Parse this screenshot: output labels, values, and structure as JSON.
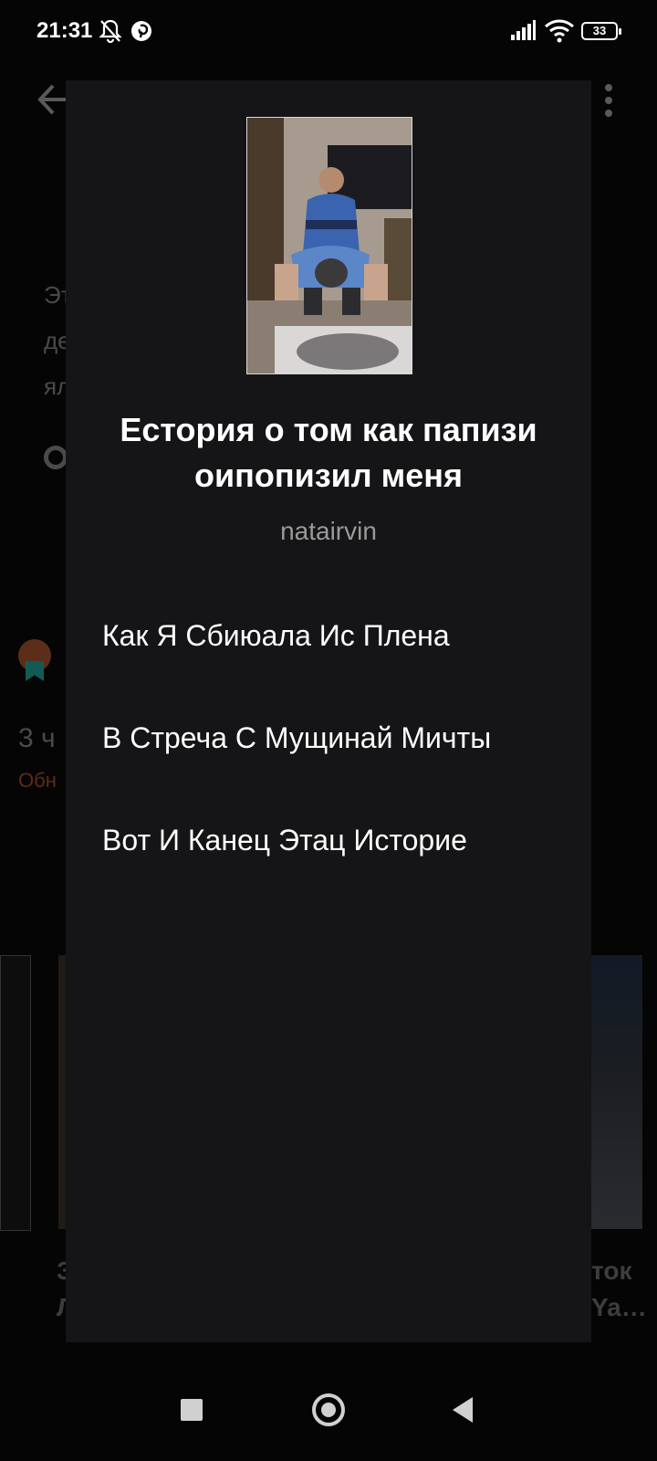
{
  "status_bar": {
    "time": "21:31",
    "battery": "33",
    "icons": [
      "bell-off-icon",
      "pinterest-icon",
      "signal-icon",
      "wifi-icon",
      "battery-icon"
    ]
  },
  "background": {
    "fragments": {
      "line1": "Эт",
      "line2": "де",
      "line3": "ял",
      "parts_count": "3 ч",
      "updated": "Обн",
      "bottom_left_1": "З",
      "bottom_left_2": "Л",
      "bottom_right_1": "ток",
      "bottom_right_2": "Ya…"
    },
    "colors": {
      "accent": "#e8692c"
    }
  },
  "dialog": {
    "title": "Естория о том как папизи оипопизил меня",
    "author": "natairvin",
    "parts": [
      "Как Я Сбиюала Ис Плена",
      "В Стреча С Мущинай Мичты",
      "Вот И Канец Этац Историе"
    ]
  },
  "nav": {
    "icons": [
      "recents-icon",
      "home-icon",
      "back-icon"
    ]
  }
}
